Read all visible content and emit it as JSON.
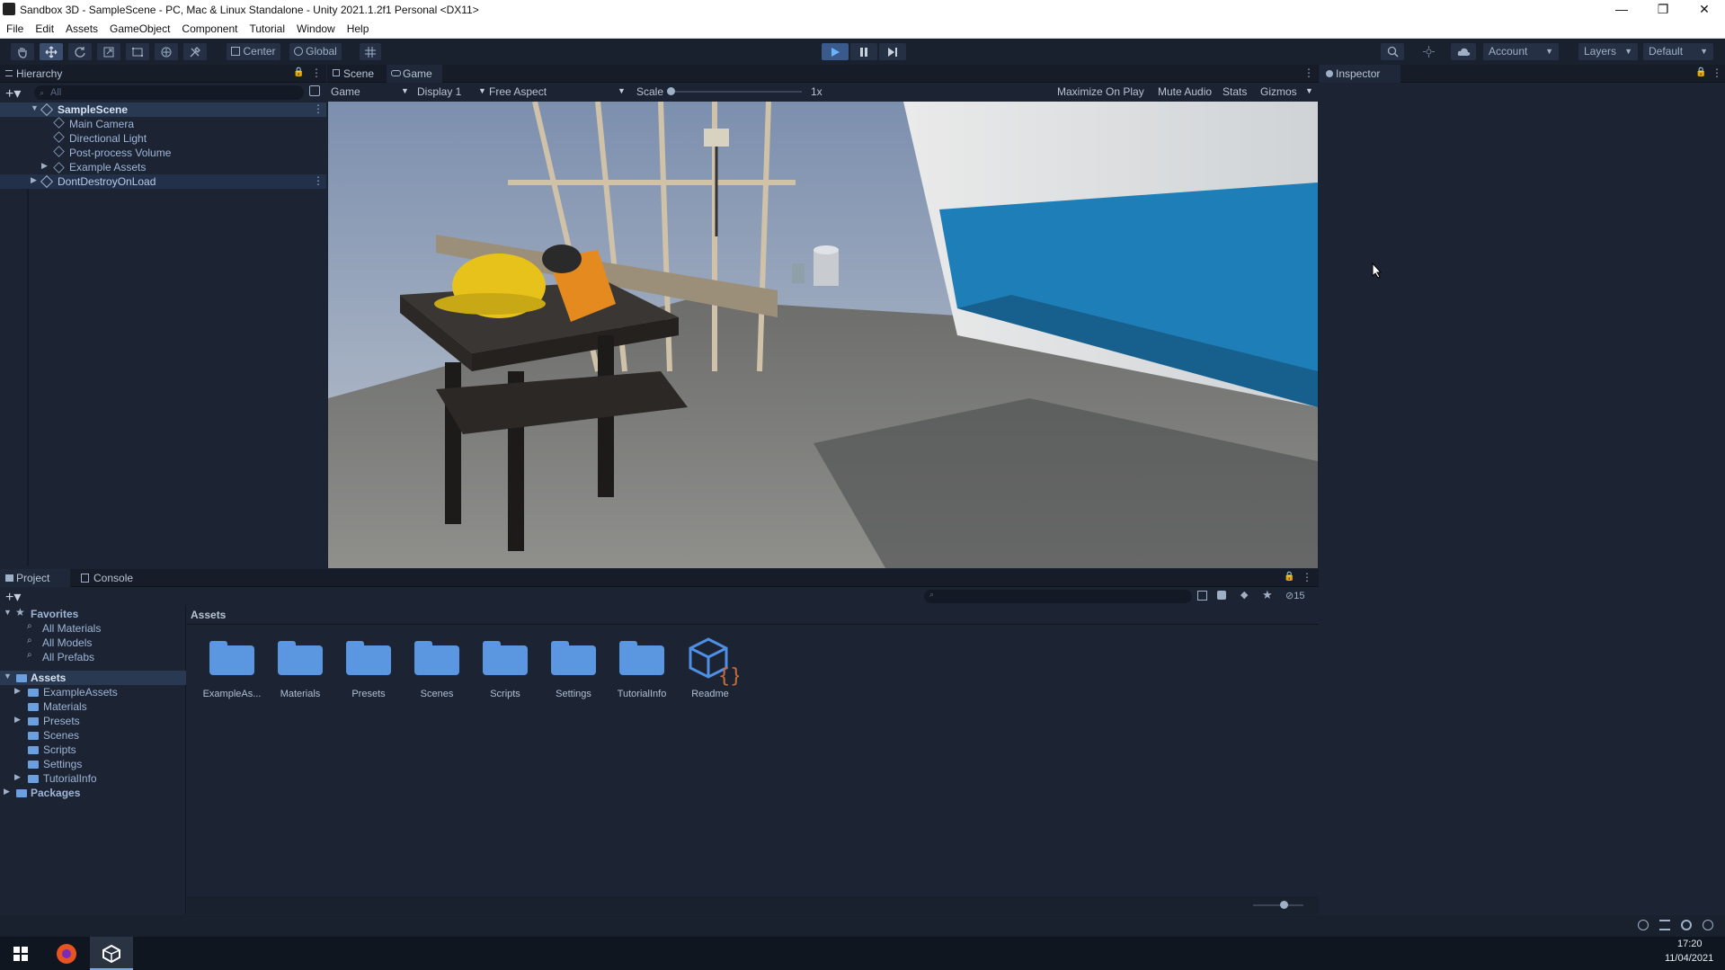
{
  "window": {
    "title": "Sandbox 3D - SampleScene - PC, Mac & Linux Standalone - Unity 2021.1.2f1 Personal <DX11>",
    "minimize": "—",
    "maximize": "❐",
    "close": "✕"
  },
  "menubar": [
    "File",
    "Edit",
    "Assets",
    "GameObject",
    "Component",
    "Tutorial",
    "Window",
    "Help"
  ],
  "toolbar": {
    "pivot": "Center",
    "space": "Global",
    "account": "Account",
    "layers": "Layers",
    "layout": "Default"
  },
  "hierarchy": {
    "tab": "Hierarchy",
    "search_placeholder": "All",
    "scene": "SampleScene",
    "items": [
      "Main Camera",
      "Directional Light",
      "Post-process Volume",
      "Example Assets"
    ],
    "dont_destroy": "DontDestroyOnLoad"
  },
  "center": {
    "tabs": [
      "Scene",
      "Game"
    ],
    "active_tab": "Game",
    "game_dropdown": "Game",
    "display": "Display 1",
    "aspect": "Free Aspect",
    "scale_label": "Scale",
    "scale_value": "1x",
    "maximize_on_play": "Maximize On Play",
    "mute_audio": "Mute Audio",
    "stats": "Stats",
    "gizmos": "Gizmos"
  },
  "inspector": {
    "tab": "Inspector"
  },
  "project": {
    "tabs": [
      "Project",
      "Console"
    ],
    "favorites_label": "Favorites",
    "favorites": [
      "All Materials",
      "All Models",
      "All Prefabs"
    ],
    "assets_label": "Assets",
    "asset_folders": [
      "ExampleAssets",
      "Materials",
      "Presets",
      "Scenes",
      "Scripts",
      "Settings",
      "TutorialInfo"
    ],
    "packages_label": "Packages",
    "breadcrumb": "Assets",
    "hidden_count": "15",
    "grid_items": [
      "ExampleAs...",
      "Materials",
      "Presets",
      "Scenes",
      "Scripts",
      "Settings",
      "TutorialInfo",
      "Readme"
    ]
  },
  "taskbar": {
    "time": "17:20",
    "date": "11/04/2021"
  }
}
